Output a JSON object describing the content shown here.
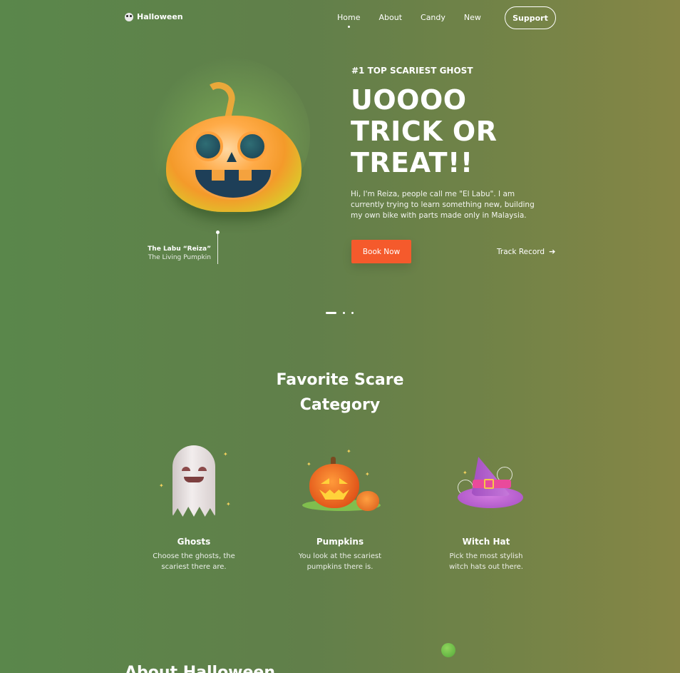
{
  "nav": {
    "logo": "Halloween",
    "links": [
      "Home",
      "About",
      "Candy",
      "New"
    ],
    "support": "Support"
  },
  "hero": {
    "kicker": "#1 TOP SCARIEST GHOST",
    "headline": [
      "UOOOO",
      "TRICK OR",
      "TREAT!!"
    ],
    "intro": "Hi, I'm Reiza, people call me \"El Labu\". I am currently trying to learn something new, building my own bike with parts made only in Malaysia.",
    "book_label": "Book Now",
    "track_label": "Track Record",
    "caption_title": "The Labu “Reiza”",
    "caption_sub": "The Living Pumpkin"
  },
  "carousel": {
    "count": 3,
    "active": 0
  },
  "category": {
    "title": [
      "Favorite Scare",
      "Category"
    ],
    "cards": [
      {
        "title": "Ghosts",
        "desc": "Choose the ghosts, the scariest there are.",
        "icon": "ghost-icon"
      },
      {
        "title": "Pumpkins",
        "desc": "You look at the scariest pumpkins there is.",
        "icon": "pumpkin-icon"
      },
      {
        "title": "Witch Hat",
        "desc": "Pick the most stylish witch hats out there.",
        "icon": "witch-hat-icon"
      }
    ]
  },
  "about": {
    "title": "About Halloween"
  },
  "colors": {
    "accent": "#f55a2c",
    "background_start": "#5a874b",
    "background_end": "#868646"
  }
}
